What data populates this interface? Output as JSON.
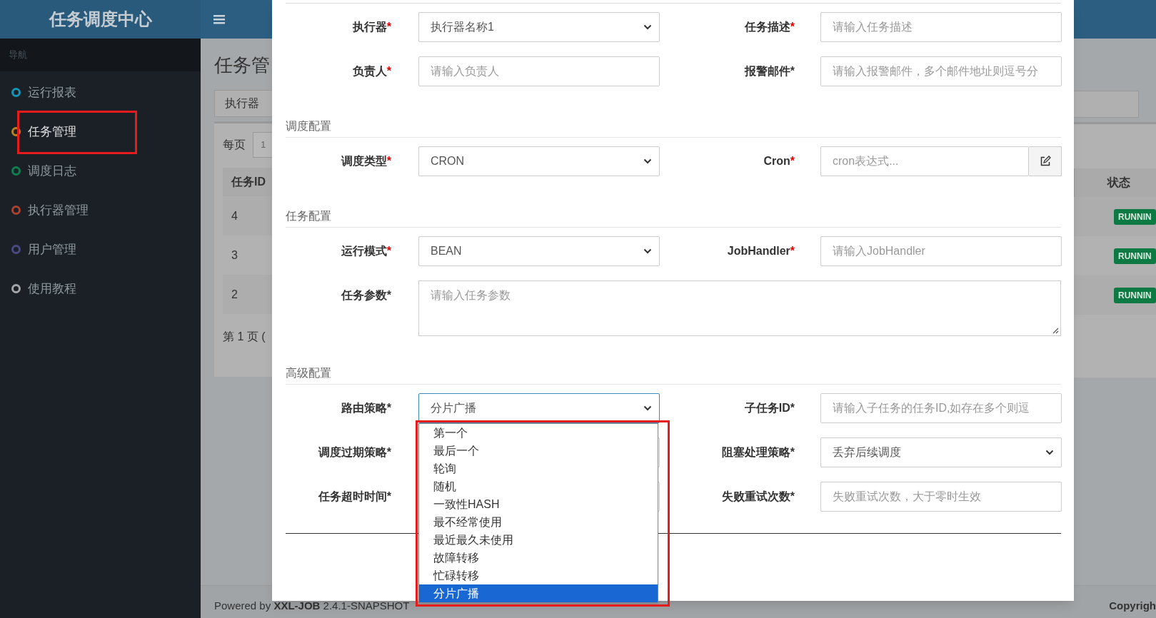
{
  "sidebar": {
    "logo": "任务调度中心",
    "header": "导航",
    "items": [
      {
        "label": "运行报表",
        "color": "#1595b5",
        "selected": false
      },
      {
        "label": "任务管理",
        "color": "#b7831c",
        "selected": true
      },
      {
        "label": "调度日志",
        "color": "#0d8050",
        "selected": false
      },
      {
        "label": "执行器管理",
        "color": "#a8432f",
        "selected": false
      },
      {
        "label": "用户管理",
        "color": "#4c4a84",
        "selected": false
      },
      {
        "label": "使用教程",
        "color": "#a4a6aa",
        "selected": false
      }
    ]
  },
  "page": {
    "title": "任务管",
    "tab": "执行器",
    "page_size_label": "每页",
    "page_size_value": "1",
    "table": {
      "columns": [
        "任务ID",
        "状态"
      ],
      "rows": [
        {
          "id": "4",
          "status": "RUNNIN"
        },
        {
          "id": "3",
          "status": "RUNNIN"
        },
        {
          "id": "2",
          "status": "RUNNIN"
        }
      ]
    },
    "pager": "第 1 页 ("
  },
  "footer": {
    "powered": "Powered by **XXL-JOB** 2.4.1-SNAPSHOT",
    "copyright": "Copyrigh"
  },
  "modal": {
    "sections": [
      {
        "rows": [
          [
            {
              "label": "执行器",
              "mark": "*",
              "mark_red": true,
              "kind": "select",
              "value": "执行器名称1"
            },
            {
              "label": "任务描述",
              "mark": "*",
              "mark_red": true,
              "kind": "input",
              "placeholder": "请输入任务描述"
            }
          ],
          [
            {
              "label": "负责人",
              "mark": "*",
              "mark_red": true,
              "kind": "input",
              "placeholder": "请输入负责人"
            },
            {
              "label": "报警邮件",
              "mark": "*",
              "mark_red": false,
              "kind": "input",
              "placeholder": "请输入报警邮件，多个邮件地址则逗号分"
            }
          ]
        ]
      },
      {
        "title": "调度配置",
        "rows": [
          [
            {
              "label": "调度类型",
              "mark": "*",
              "mark_red": true,
              "kind": "select",
              "value": "CRON"
            },
            {
              "label": "Cron",
              "mark": "*",
              "mark_red": true,
              "kind": "input_button",
              "placeholder": "cron表达式..."
            }
          ]
        ]
      },
      {
        "title": "任务配置",
        "rows": [
          [
            {
              "label": "运行模式",
              "mark": "*",
              "mark_red": true,
              "kind": "select",
              "value": "BEAN"
            },
            {
              "label": "JobHandler",
              "mark": "*",
              "mark_red": true,
              "kind": "input",
              "placeholder": "请输入JobHandler"
            }
          ],
          [
            {
              "label": "任务参数",
              "mark": "*",
              "mark_red": false,
              "kind": "textarea",
              "placeholder": "请输入任务参数"
            }
          ]
        ]
      },
      {
        "title": "高级配置",
        "rows": [
          [
            {
              "label": "路由策略",
              "mark": "*",
              "mark_red": false,
              "kind": "open_select",
              "value": "分片广播"
            },
            {
              "label": "子任务ID",
              "mark": "*",
              "mark_red": false,
              "kind": "input",
              "placeholder": "请输入子任务的任务ID,如存在多个则逗"
            }
          ],
          [
            {
              "label": "调度过期策略",
              "mark": "*",
              "mark_red": false,
              "kind": "select"
            },
            {
              "label": "阻塞处理策略",
              "mark": "*",
              "mark_red": false,
              "kind": "select",
              "value": "丢弃后续调度"
            }
          ],
          [
            {
              "label": "任务超时时间",
              "mark": "*",
              "mark_red": false,
              "kind": "input"
            },
            {
              "label": "失败重试次数",
              "mark": "*",
              "mark_red": false,
              "kind": "input",
              "placeholder": "失败重试次数，大于零时生效"
            }
          ]
        ],
        "dropdown": {
          "options": [
            {
              "label": "第一个",
              "selected": false
            },
            {
              "label": "最后一个",
              "selected": false
            },
            {
              "label": "轮询",
              "selected": false
            },
            {
              "label": "随机",
              "selected": false
            },
            {
              "label": "一致性HASH",
              "selected": false
            },
            {
              "label": "最不经常使用",
              "selected": false
            },
            {
              "label": "最近最久未使用",
              "selected": false
            },
            {
              "label": "故障转移",
              "selected": false
            },
            {
              "label": "忙碌转移",
              "selected": false
            },
            {
              "label": "分片广播",
              "selected": true
            }
          ]
        }
      }
    ]
  }
}
